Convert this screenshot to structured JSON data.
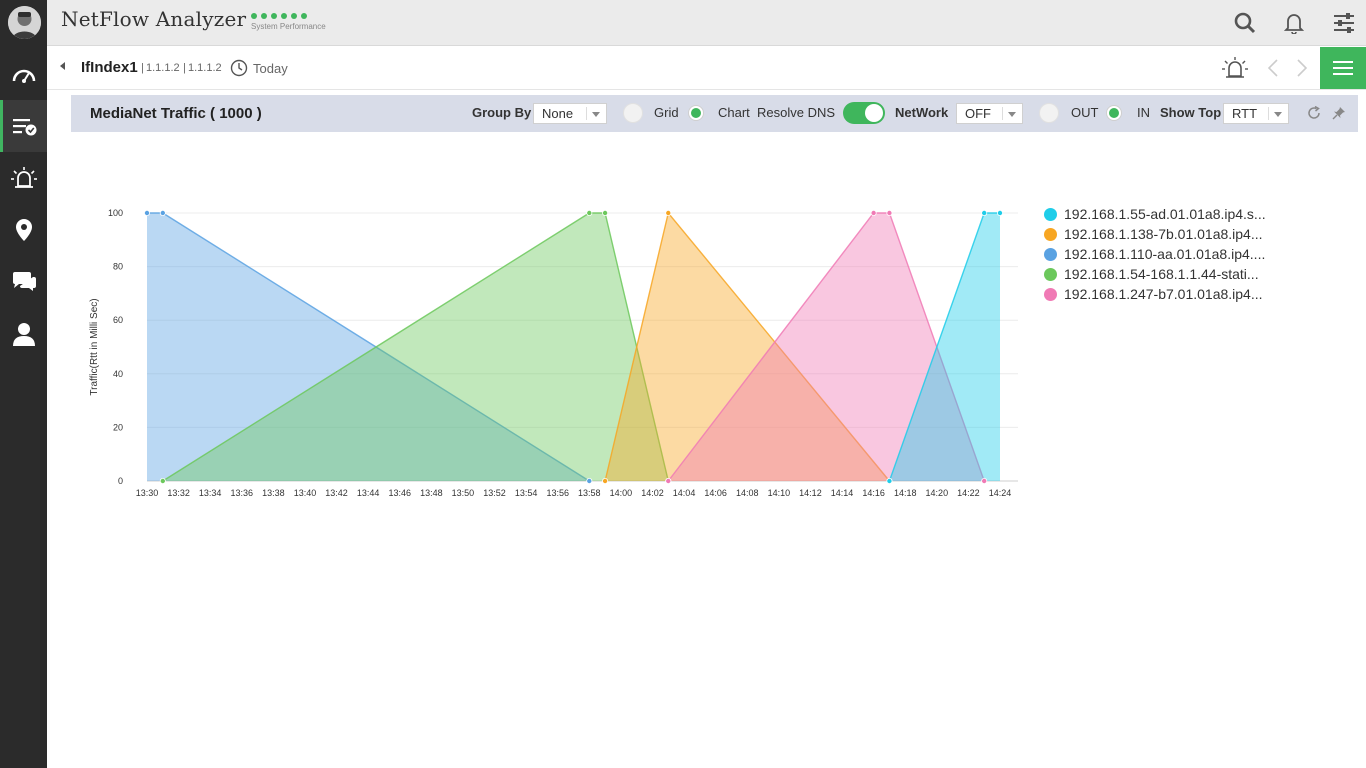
{
  "app": {
    "title": "NetFlow Analyzer",
    "status_label": "System Performance"
  },
  "breadcrumb": {
    "title": "IfIndex1",
    "ip_a": "1.1.1.2",
    "ip_b": "1.1.1.2",
    "period": "Today"
  },
  "toolbar": {
    "title": "MediaNet Traffic ( 1000 )",
    "group_by_label": "Group By",
    "group_by_value": "None",
    "grid_label": "Grid",
    "chart_label": "Chart",
    "grid_chart_selected": "Chart",
    "resolve_dns_label": "Resolve DNS",
    "resolve_dns_on": true,
    "network_label": "NetWork",
    "network_value": "OFF",
    "out_label": "OUT",
    "in_label": "IN",
    "direction_selected": "IN",
    "show_top_label": "Show Top",
    "show_top_value": "RTT"
  },
  "icons": {
    "rail": [
      "dashboard-icon",
      "traffic-list-icon",
      "alarm-icon",
      "location-icon",
      "chat-icon",
      "user-icon"
    ],
    "top": [
      "search-icon",
      "bell-icon",
      "settings-sliders-icon"
    ]
  },
  "colors": {
    "accent": "#3fb65c",
    "rail_bg": "#2b2b2b"
  },
  "chart_data": {
    "type": "area",
    "ylabel": "Traffic(Rtt in Milli Sec)",
    "xlabel": "",
    "ylim": [
      0,
      100
    ],
    "y_ticks": [
      "0",
      "20",
      "40",
      "60",
      "80",
      "100"
    ],
    "x_ticks": [
      "13:30",
      "13:32",
      "13:34",
      "13:36",
      "13:38",
      "13:40",
      "13:42",
      "13:44",
      "13:46",
      "13:48",
      "13:50",
      "13:52",
      "13:54",
      "13:56",
      "13:58",
      "14:00",
      "14:02",
      "14:04",
      "14:06",
      "14:08",
      "14:10",
      "14:12",
      "14:14",
      "14:16",
      "14:18",
      "14:20",
      "14:22",
      "14:24"
    ],
    "grid": true,
    "legend_position": "right",
    "series": [
      {
        "name": "192.168.1.55-ad.01.01a8.ip4.s...",
        "color": "#1fcde9",
        "points": [
          [
            "14:17",
            0
          ],
          [
            "14:23",
            100
          ],
          [
            "14:24",
            100
          ]
        ]
      },
      {
        "name": "192.168.1.138-7b.01.01a8.ip4...",
        "color": "#f7a623",
        "points": [
          [
            "13:59",
            0
          ],
          [
            "14:03",
            100
          ],
          [
            "14:17",
            0
          ]
        ]
      },
      {
        "name": "192.168.1.110-aa.01.01a8.ip4....",
        "color": "#5aa2e2",
        "points": [
          [
            "13:30",
            100
          ],
          [
            "13:31",
            100
          ],
          [
            "13:58",
            0
          ]
        ]
      },
      {
        "name": "192.168.1.54-168.1.1.44-stati...",
        "color": "#6cc85c",
        "points": [
          [
            "13:31",
            0
          ],
          [
            "13:58",
            100
          ],
          [
            "13:59",
            100
          ],
          [
            "14:03",
            0
          ]
        ]
      },
      {
        "name": "192.168.1.247-b7.01.01a8.ip4...",
        "color": "#f07ab5",
        "points": [
          [
            "14:03",
            0
          ],
          [
            "14:16",
            100
          ],
          [
            "14:17",
            100
          ],
          [
            "14:23",
            0
          ]
        ]
      }
    ]
  }
}
